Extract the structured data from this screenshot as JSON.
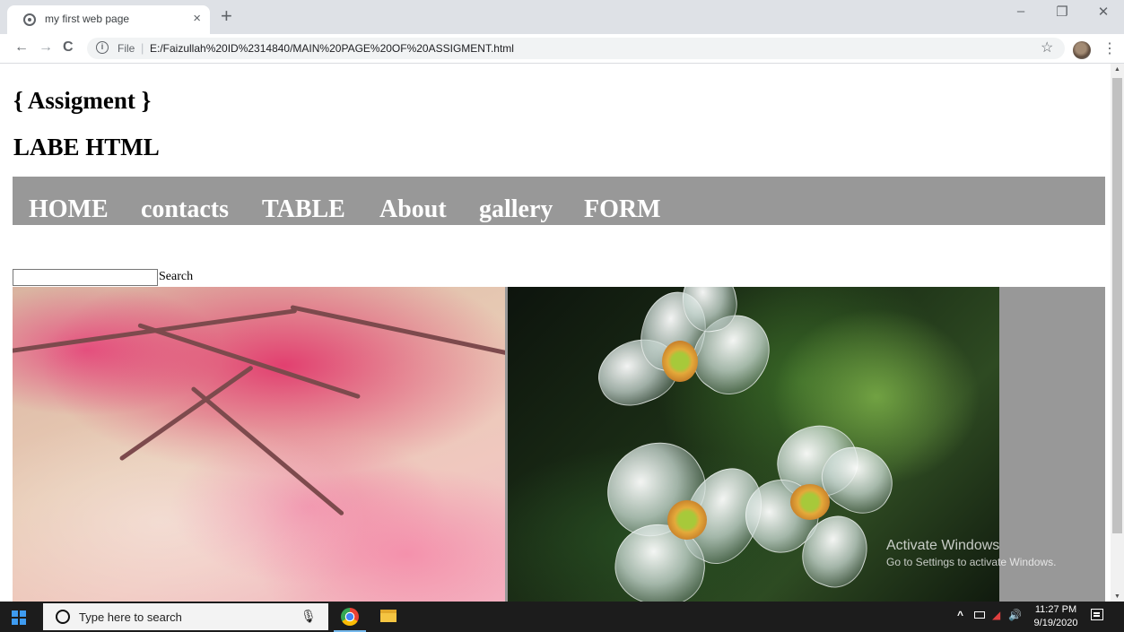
{
  "browser": {
    "tab_title": "my first web page",
    "tab_close": "×",
    "new_tab": "+",
    "window": {
      "minimize": "–",
      "restore": "❐",
      "close": "✕"
    },
    "back": "←",
    "forward": "→",
    "reload": "C",
    "address_scheme": "File",
    "address_separator": "|",
    "address_url": "E:/Faizullah%20ID%2314840/MAIN%20PAGE%20OF%20ASSIGMENT.html",
    "bookmark": "☆",
    "menu": "⋮"
  },
  "page": {
    "heading1": "{ Assigment }",
    "heading2": "LABE HTML",
    "nav": [
      "HOME",
      "contacts",
      "TABLE",
      "About",
      "gallery",
      "FORM"
    ],
    "search_button": "Search",
    "search_value": "",
    "nav_color": "#989898",
    "images": [
      "pink blossom branch photo",
      "transparent petal flower photo"
    ]
  },
  "watermark": {
    "line1": "Activate Windows",
    "line2": "Go to Settings to activate Windows."
  },
  "scrollbar": {
    "up": "▲",
    "down": "▼"
  },
  "taskbar": {
    "search_placeholder": "Type here to search",
    "tray_chevron": "^",
    "tray_volume": "🔊",
    "time": "11:27 PM",
    "date": "9/19/2020",
    "accent": "#3e9bf0"
  }
}
